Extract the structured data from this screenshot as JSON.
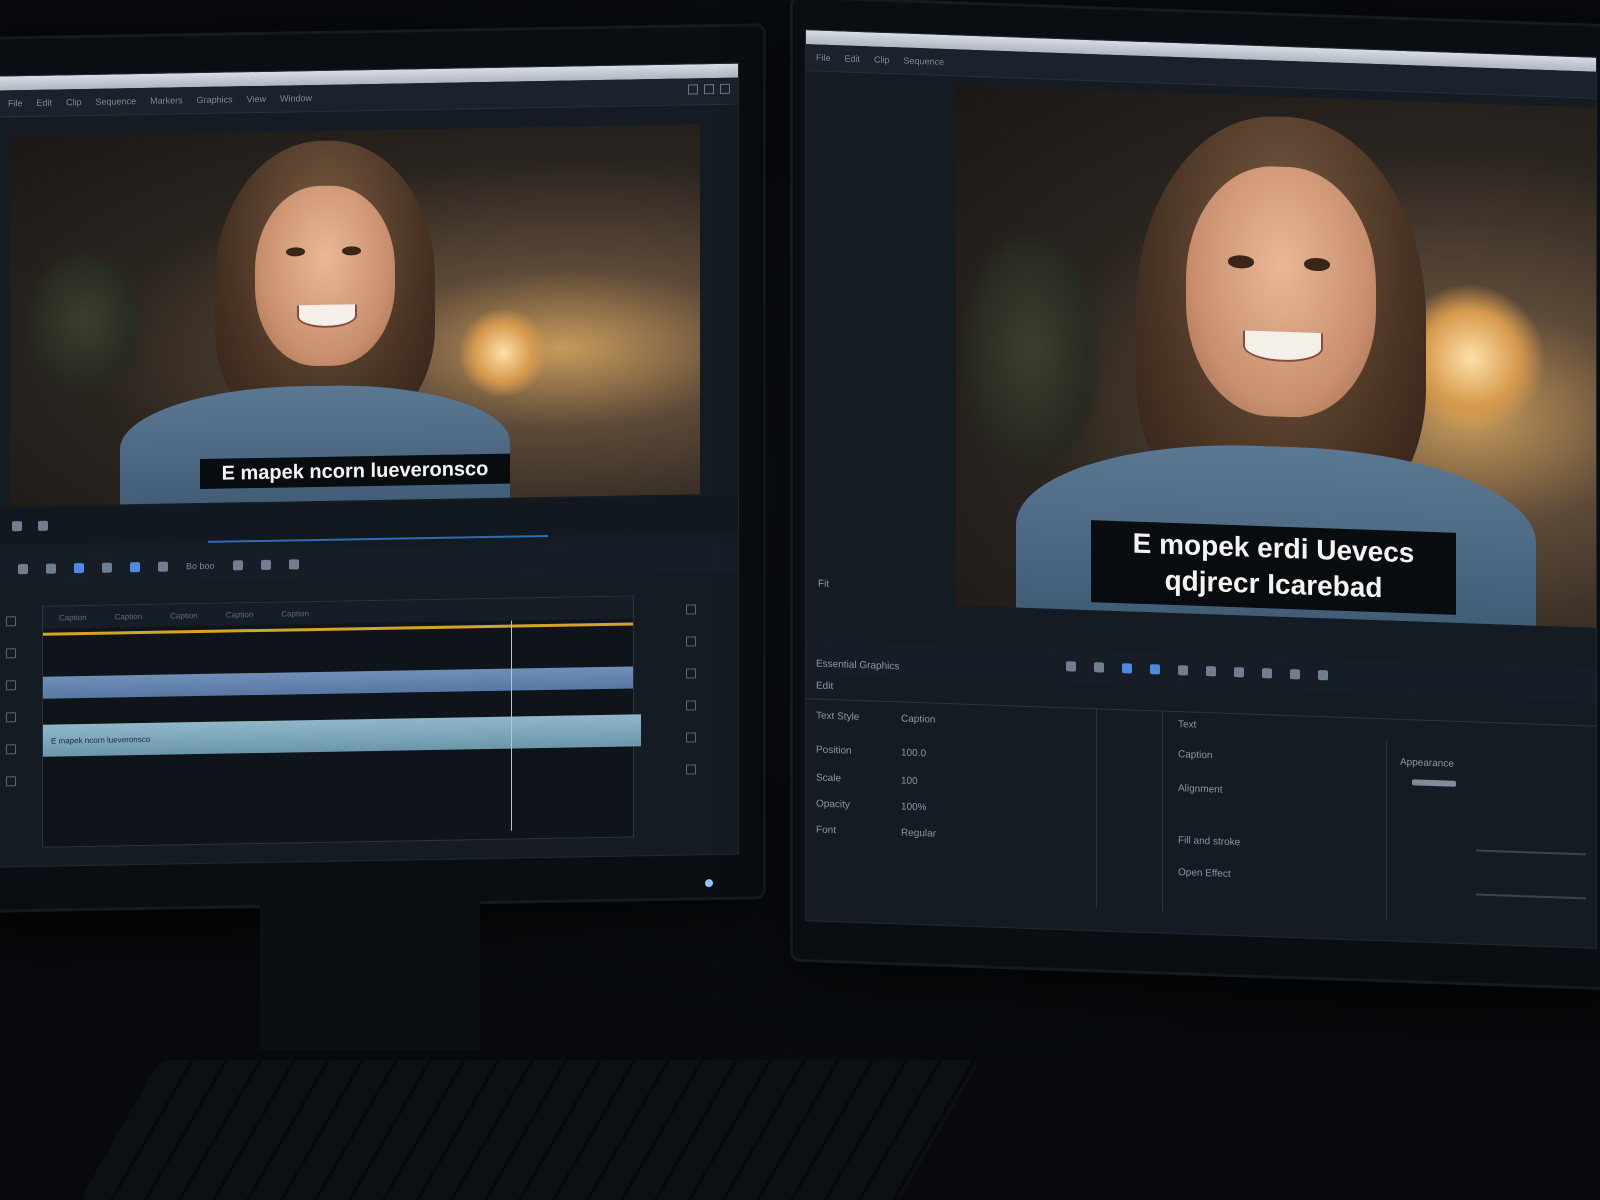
{
  "left_editor": {
    "caption": "E mapek ncorn lueveronsco",
    "menu": [
      "File",
      "Edit",
      "Clip",
      "Sequence",
      "Markers",
      "Graphics",
      "View",
      "Window"
    ],
    "toolbar_label": "Bo boo",
    "clip_labels": [
      "Caption",
      "Caption",
      "Caption",
      "Caption",
      "Caption"
    ]
  },
  "right_editor": {
    "caption_line1": "E mopek erdi Uevecs",
    "caption_line2": "qdjrecr Icarebad",
    "menu": [
      "File",
      "Edit",
      "Clip",
      "Sequence"
    ],
    "under_viewer_label": "Fit",
    "panel_title": "Essential Graphics",
    "panel_sub": "Edit",
    "rows": [
      "Text Style",
      "Position",
      "Scale",
      "Opacity",
      "Font"
    ],
    "row_values": [
      "Caption",
      "100.0",
      "100",
      "100%",
      "Regular"
    ],
    "section_header": "Text",
    "section_items": [
      "Caption",
      "Alignment",
      "Fill and stroke",
      "Open Effect"
    ],
    "right_col_label": "Appearance"
  }
}
